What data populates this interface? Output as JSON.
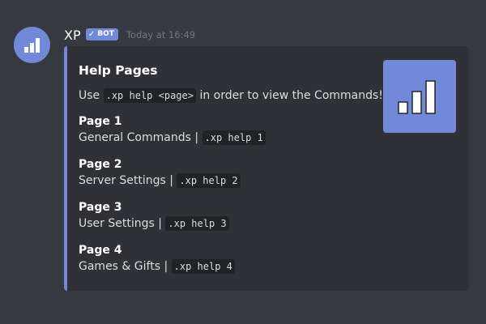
{
  "author": {
    "name": "XP",
    "bot_tag": "BOT",
    "timestamp": "Today at 16:49",
    "avatar_icon": "bar-chart-icon"
  },
  "embed": {
    "accent_color": "#7289da",
    "title": "Help Pages",
    "description": {
      "prefix": "Use",
      "code": ".xp help <page>",
      "suffix": "in order to view the Commands!"
    },
    "thumbnail_icon": "bar-chart-icon",
    "fields": [
      {
        "name": "Page 1",
        "text": "General Commands |",
        "code": ".xp help 1"
      },
      {
        "name": "Page 2",
        "text": "Server Settings |",
        "code": ".xp help 2"
      },
      {
        "name": "Page 3",
        "text": "User Settings |",
        "code": ".xp help 3"
      },
      {
        "name": "Page 4",
        "text": "Games & Gifts |",
        "code": ".xp help 4"
      }
    ]
  }
}
